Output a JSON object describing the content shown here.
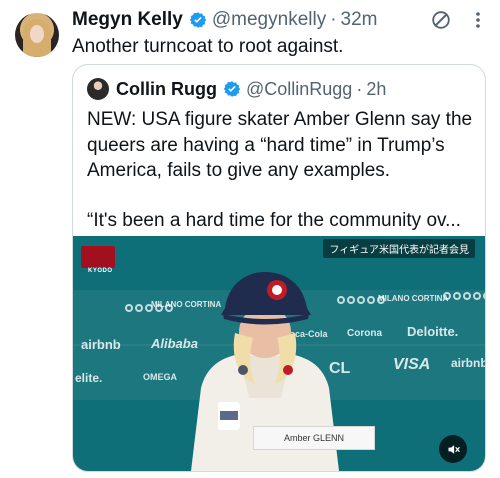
{
  "post": {
    "author_name": "Megyn Kelly",
    "handle": "@megynkelly",
    "separator": "·",
    "time": "32m",
    "text": "Another turncoat to root against."
  },
  "quoted": {
    "author_name": "Collin Rugg",
    "handle": "@CollinRugg",
    "separator": "·",
    "time": "2h",
    "paragraph_1": "NEW: USA figure skater Amber Glenn say the queers are having a “hard time” in Trump’s America, fails to give any examples.",
    "paragraph_2": "“It's been a hard time for the community ov..."
  },
  "video": {
    "caption": "フィギュア米国代表が記者会見",
    "kyodo": "KYODO",
    "sponsors": {
      "airbnb": "airbnb",
      "alibaba": "Alibaba",
      "deloitte": "Deloitte.",
      "visa": "VISA",
      "omega": "OMEGA",
      "cortina": "MILANO CORTINA",
      "corona": "Corona",
      "cocacola": "Coca-Cola",
      "cl": "CL",
      "elite": "elite."
    },
    "nameplate": "Amber GLENN"
  },
  "icons": [
    "verified-badge-icon",
    "grok-icon",
    "more-options-icon",
    "mute-icon"
  ],
  "colors": {
    "verified": "#1d9bf0",
    "text": "#0f1419",
    "secondary": "#536471",
    "border": "#cfd9de",
    "video_bg": "#0f6f78",
    "mute_bg": "#000000"
  }
}
